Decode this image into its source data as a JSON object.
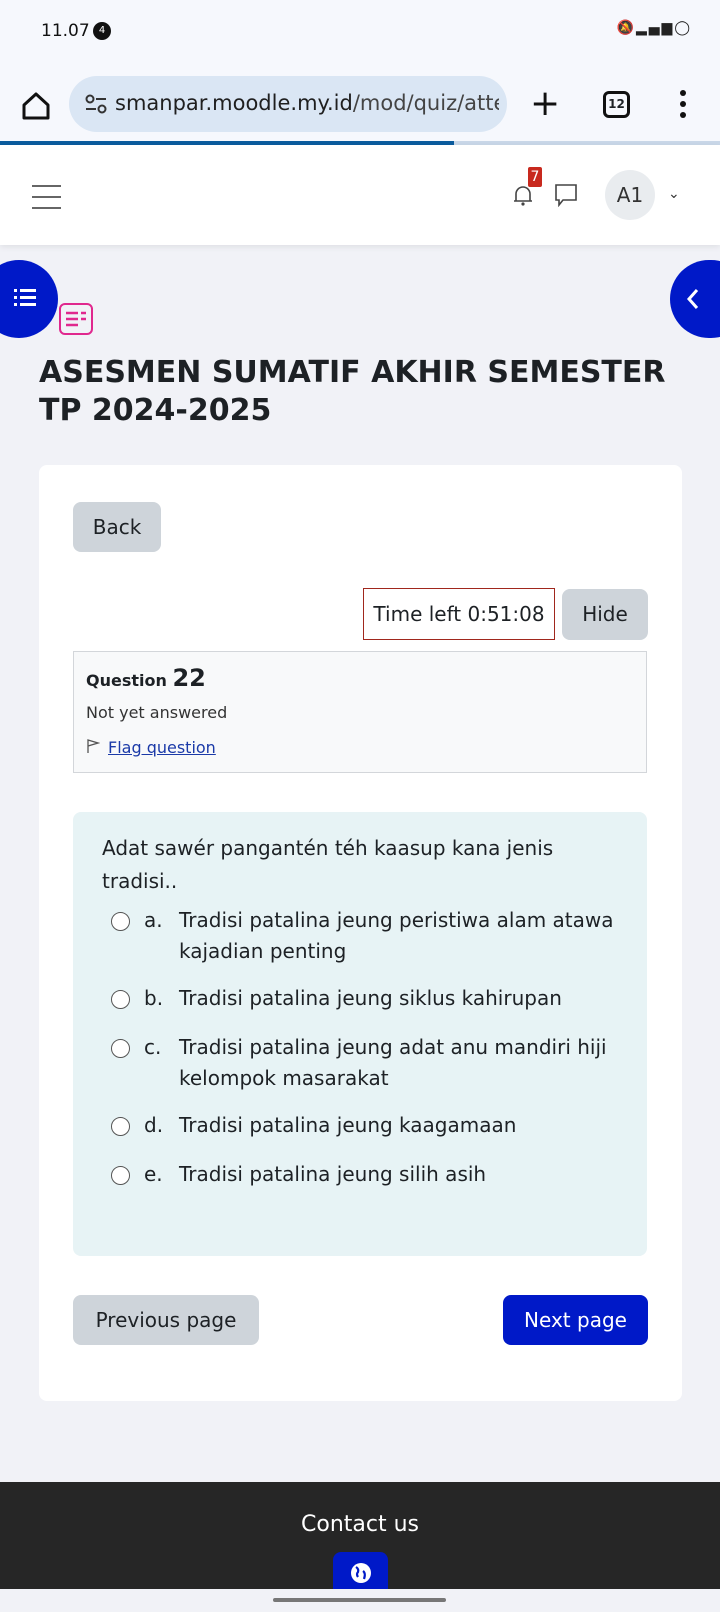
{
  "status_bar": {
    "time": "11.07",
    "notification_count": "4",
    "icons": [
      "mute-icon",
      "4g-icon",
      "signal-icon",
      "battery-icon"
    ]
  },
  "browser": {
    "url_host": "smanpar.moodle.my.id",
    "url_path": "/mod/quiz/atte",
    "tab_count": "12",
    "load_progress": 0.63
  },
  "header": {
    "notification_badge": "7",
    "avatar_initials": "A1"
  },
  "page": {
    "title": "ASESMEN SUMATIF AKHIR SEMESTER TP 2024-2025"
  },
  "quiz": {
    "back_label": "Back",
    "timer": "Time left 0:51:08",
    "hide_label": "Hide",
    "question_label": "Question",
    "question_number": "22",
    "question_state": "Not yet answered",
    "flag_label": "Flag question",
    "question_text": "Adat sawér pangantén téh kaasup kana jenis tradisi..",
    "options": [
      {
        "letter": "a.",
        "text": "Tradisi patalina jeung peristiwa alam atawa kajadian penting"
      },
      {
        "letter": "b.",
        "text": "Tradisi patalina jeung siklus kahirupan"
      },
      {
        "letter": "c.",
        "text": "Tradisi patalina jeung adat anu mandiri hiji kelompok masarakat"
      },
      {
        "letter": "d.",
        "text": "Tradisi patalina jeung kaagamaan"
      },
      {
        "letter": "e.",
        "text": "Tradisi patalina jeung silih asih"
      }
    ],
    "prev_label": "Previous page",
    "next_label": "Next page"
  },
  "footer": {
    "contact_label": "Contact us"
  },
  "colors": {
    "primary": "#0019c8",
    "timer_border": "#a0271d",
    "badge": "#c8291e",
    "quiz_icon": "#e0288e",
    "question_bg": "#e7f3f5"
  }
}
